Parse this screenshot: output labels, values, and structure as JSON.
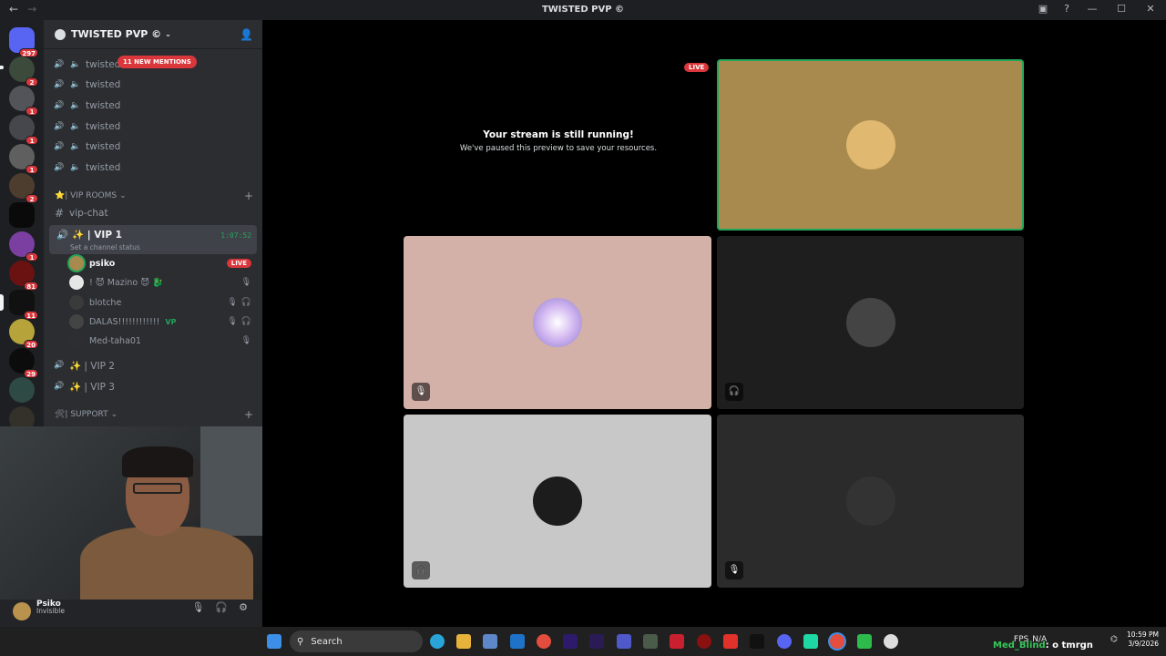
{
  "window": {
    "title": "TWISTED PVP ©"
  },
  "guilds": [
    {
      "badge": "297"
    },
    {
      "badge": "2"
    },
    {
      "badge": "1"
    },
    {
      "badge": "1"
    },
    {
      "badge": "1"
    },
    {
      "badge": "2"
    },
    {
      "badge": ""
    },
    {
      "badge": "1"
    },
    {
      "badge": "81"
    },
    {
      "badge": "11"
    },
    {
      "badge": "20"
    },
    {
      "badge": "29"
    },
    {
      "badge": ""
    },
    {
      "badge": ""
    }
  ],
  "server": {
    "name": "TWISTED PVP ©",
    "mentions": "11 NEW MENTIONS",
    "channels": [
      "twisted",
      "twisted",
      "twisted",
      "twisted",
      "twisted",
      "twisted"
    ],
    "vip_category": "⭐| VIP ROOMS",
    "vip_chat": "vip-chat",
    "vip1": {
      "name": "✨ | VIP 1",
      "status": "Set a channel status",
      "timer": "1:07:52"
    },
    "members": [
      {
        "name": "psiko",
        "tag": "LIVE"
      },
      {
        "name": "! 😈 Mazino 😈 🐉",
        "tag": ""
      },
      {
        "name": "blotche",
        "tag": ""
      },
      {
        "name": "DALAS!!!!!!!!!!!!",
        "tag": "VP"
      },
      {
        "name": "Med-taha01",
        "tag": ""
      }
    ],
    "vip2": "✨ | VIP 2",
    "vip3": "✨ | VIP 3",
    "support_category": "🛠| SUPPORT"
  },
  "user": {
    "name": "Psiko",
    "status": "Invisible"
  },
  "stage": {
    "live_label": "LIVE",
    "paused_title": "Your stream is still running!",
    "paused_sub": "We've paused this preview to save your resources."
  },
  "taskbar": {
    "search": "Search",
    "fps": "FPS",
    "fps_value": "N/A",
    "time": "10:59 PM",
    "date": "3/9/2026",
    "overlay_name": "Med_Blind",
    "overlay_text": ": o tmrgn"
  },
  "colors": {
    "live": "#da373c",
    "speaking": "#23a559",
    "tile_gold": "#a88a4e",
    "tile_pink": "#d3b0a8",
    "tile_gray": "#c8c8c8"
  }
}
